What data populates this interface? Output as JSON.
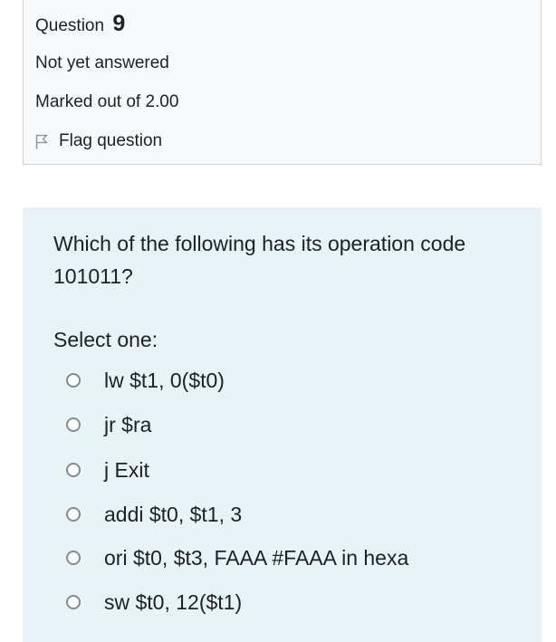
{
  "question_info": {
    "title": "Question",
    "number": "9",
    "state": "Not yet answered",
    "grade": "Marked out of 2.00",
    "flag_label": "Flag question"
  },
  "question": {
    "text": "Which of the following has its operation code 101011?",
    "prompt": "Select one:",
    "options": [
      {
        "label": "lw $t1, 0($t0)",
        "selected": false
      },
      {
        "label": "jr $ra",
        "selected": false
      },
      {
        "label": "j Exit",
        "selected": false
      },
      {
        "label": "addi $t0, $t1, 3",
        "selected": false
      },
      {
        "label": "ori $t0, $t3, FAAA #FAAA in hexa",
        "selected": false
      },
      {
        "label": "sw $t0, 12($t1)",
        "selected": false
      }
    ]
  },
  "colors": {
    "info_background": "#f8f9fa",
    "formulation_background": "#e7f3f5",
    "text": "#1d2125"
  },
  "icons": {
    "flag": "flag-outline-icon",
    "radio": "radio-unchecked-icon"
  }
}
